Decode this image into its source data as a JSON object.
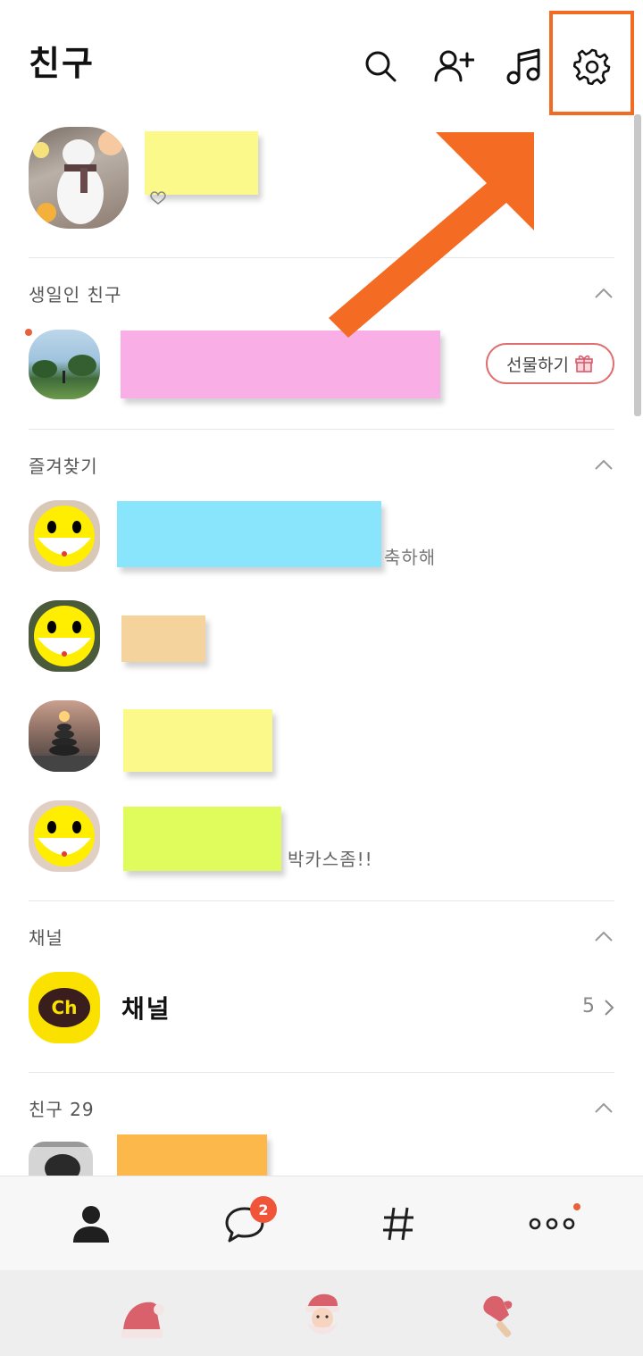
{
  "header": {
    "title": "친구"
  },
  "sections": {
    "birthday": {
      "title": "생일인 친구",
      "gift_label": "선물하기"
    },
    "favorites": {
      "title": "즐겨찾기",
      "items": [
        {
          "status": "축하해"
        },
        {
          "status": ""
        },
        {
          "status": ""
        },
        {
          "status": "박카스좀!!"
        }
      ]
    },
    "channel": {
      "title": "채널",
      "name": "채널",
      "count": "5",
      "logo_text": "Ch"
    },
    "friends": {
      "title": "친구 29"
    }
  },
  "tabbar": {
    "chat_badge": "2"
  },
  "colors": {
    "accent": "#f26b22",
    "badge": "#f0553a",
    "channel_yellow": "#fae100",
    "note_yellow": "#fbf98a",
    "note_pink": "#f9aee6",
    "note_cyan": "#88e5fb",
    "note_tan": "#f4d49c",
    "note_lime": "#dffb5c",
    "note_orange": "#fdb84c"
  },
  "icons": {
    "header": [
      "search-icon",
      "add-friend-icon",
      "music-icon",
      "settings-icon"
    ],
    "tabs": [
      "person-icon",
      "chat-icon",
      "hashtag-icon",
      "more-icon"
    ]
  }
}
